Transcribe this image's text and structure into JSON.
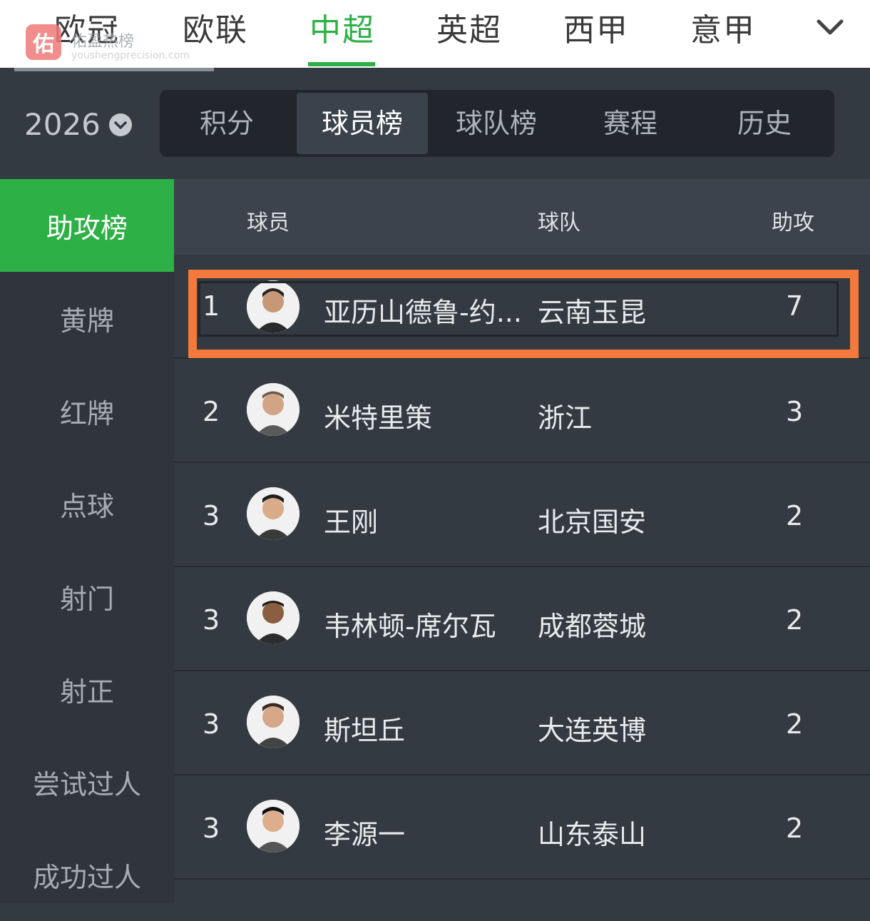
{
  "logo": {
    "text": "佑",
    "name": "佑盈热榜",
    "url": "youshengprecision.com"
  },
  "leagues": [
    "欧冠",
    "欧联",
    "中超",
    "英超",
    "西甲",
    "意甲"
  ],
  "season": "2026",
  "subtabs": [
    "积分",
    "球员榜",
    "球队榜",
    "赛程",
    "历史"
  ],
  "sidebar": [
    "助攻榜",
    "黄牌",
    "红牌",
    "点球",
    "射门",
    "射正",
    "尝试过人",
    "成功过人"
  ],
  "table": {
    "headers": {
      "player": "球员",
      "team": "球队",
      "stat": "助攻"
    },
    "rows": [
      {
        "rank": "1",
        "player": "亚历山德鲁-约...",
        "team": "云南玉昆",
        "value": "7"
      },
      {
        "rank": "2",
        "player": "米特里策",
        "team": "浙江",
        "value": "3"
      },
      {
        "rank": "3",
        "player": "王刚",
        "team": "北京国安",
        "value": "2"
      },
      {
        "rank": "3",
        "player": "韦林顿-席尔瓦",
        "team": "成都蓉城",
        "value": "2"
      },
      {
        "rank": "3",
        "player": "斯坦丘",
        "team": "大连英博",
        "value": "2"
      },
      {
        "rank": "3",
        "player": "李源一",
        "team": "山东泰山",
        "value": "2"
      }
    ]
  },
  "colors": {
    "accent": "#2db045",
    "highlight": "#f37a3c",
    "background": "#343a42"
  }
}
